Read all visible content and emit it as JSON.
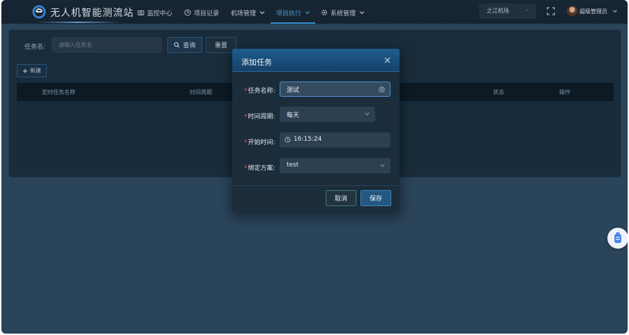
{
  "app": {
    "title": "无人机智能测流站"
  },
  "nav": {
    "items": [
      {
        "label": "监控中心",
        "icon": "camera-icon"
      },
      {
        "label": "项目记录",
        "icon": "clock-icon"
      },
      {
        "label": "机场管理",
        "icon": "chevron-down-icon"
      },
      {
        "label": "项目执行",
        "icon": "chevron-down-icon",
        "active": true
      },
      {
        "label": "系统管理",
        "icon": "gear-icon"
      }
    ]
  },
  "header": {
    "airport": "之江机场",
    "user": "超级管理员"
  },
  "filter": {
    "label": "任务名:",
    "placeholder": "请输入任务名",
    "query_label": "查询",
    "reset_label": "重置",
    "new_label": "新建"
  },
  "table": {
    "columns": [
      "定时任务名称",
      "时间周期",
      "状态",
      "操作"
    ]
  },
  "modal": {
    "title": "添加任务",
    "fields": [
      {
        "label": "任务名称:",
        "value": "测试"
      },
      {
        "label": "时间周期:",
        "value": "每天"
      },
      {
        "label": "开始时间:",
        "value": "16:15:24"
      },
      {
        "label": "绑定方案:",
        "value": "test"
      }
    ],
    "cancel_label": "取消",
    "save_label": "保存"
  },
  "colors": {
    "accent": "#3a9bd9",
    "header_bg": "#172634",
    "modal_header": "#1f5c8f",
    "required": "#e0574f"
  }
}
